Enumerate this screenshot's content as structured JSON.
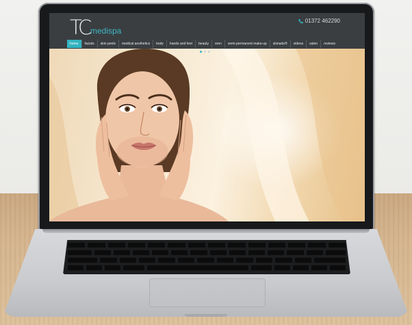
{
  "brand": {
    "logo_mark": "TC",
    "logo_text": "medispa",
    "accent_color": "#34b3c0"
  },
  "header": {
    "phone_icon": "phone-icon",
    "phone_number": "01372 462290"
  },
  "nav": {
    "items": [
      {
        "label": "home",
        "active": true
      },
      {
        "label": "facials"
      },
      {
        "label": "skin peels"
      },
      {
        "label": "medical aesthetics"
      },
      {
        "label": "body"
      },
      {
        "label": "hands and feet"
      },
      {
        "label": "beauty"
      },
      {
        "label": "men"
      },
      {
        "label": "semi-permanent make-up"
      },
      {
        "label": "skinade®"
      },
      {
        "label": "videos"
      },
      {
        "label": "salon"
      },
      {
        "label": "reviews"
      }
    ]
  },
  "hero": {
    "slide_count": 3,
    "active_slide": 1
  }
}
